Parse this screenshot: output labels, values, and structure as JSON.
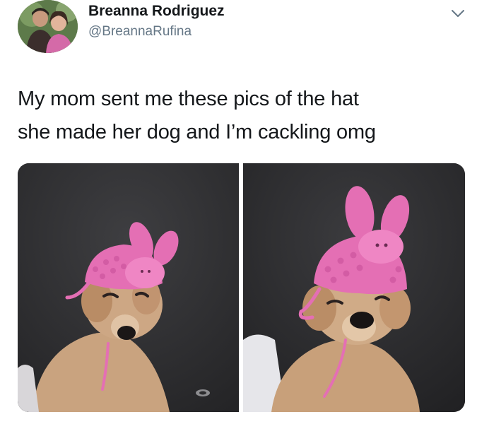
{
  "tweet": {
    "author": {
      "display_name": "Breanna Rodriguez",
      "handle": "@BreannaRufina"
    },
    "text_line1": "My mom sent me these pics of the hat",
    "text_line2": "she made her dog and I’m cackling omg",
    "menu_icon": "chevron-down-icon",
    "media": [
      {
        "description_id": "dog-photo-1"
      },
      {
        "description_id": "dog-photo-2"
      }
    ]
  },
  "colors": {
    "text_primary": "#14171a",
    "text_secondary": "#657786",
    "hat_pink": "#e46fb4"
  }
}
